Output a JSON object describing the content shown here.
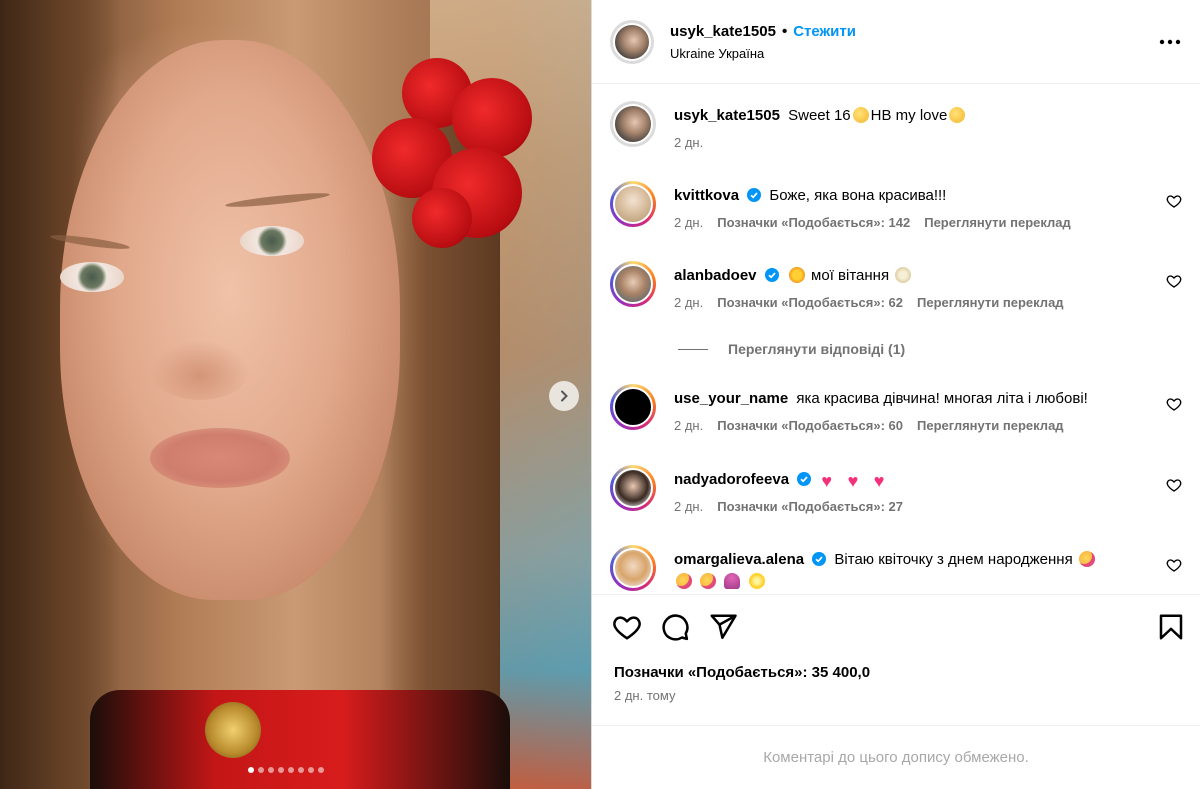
{
  "photo": {
    "alt_description_hidden": "",
    "carousel_dots": 8,
    "active_dot": 0
  },
  "header": {
    "username": "usyk_kate1505",
    "separator": "•",
    "follow_label": "Стежити",
    "location": "Ukraine Україна"
  },
  "caption": {
    "username": "usyk_kate1505",
    "text_part1": "Sweet 16",
    "text_part2": "HB my love",
    "time": "2 дн."
  },
  "comments": [
    {
      "username": "kvittkova",
      "verified": true,
      "text": "Боже, яка вона красива!!!",
      "time": "2 дн.",
      "likes": "Позначки «Подобається»: 142",
      "translate": "Переглянути переклад"
    },
    {
      "username": "alanbadoev",
      "verified": true,
      "text": "мої вітання",
      "time": "2 дн.",
      "likes": "Позначки «Подобається»: 62",
      "translate": "Переглянути переклад"
    },
    {
      "username": "use_your_name",
      "verified": false,
      "text": "яка красива дівчина! многая літа і любові!",
      "time": "2 дн.",
      "likes": "Позначки «Подобається»: 60",
      "translate": "Переглянути переклад"
    },
    {
      "username": "nadyadorofeeva",
      "verified": true,
      "text": "",
      "time": "2 дн.",
      "likes": "Позначки «Подобається»: 27",
      "translate": ""
    },
    {
      "username": "omargalieva.alena",
      "verified": true,
      "text": "Вітаю квіточку з днем народження",
      "time": "",
      "likes": "",
      "translate": ""
    }
  ],
  "view_replies": "Переглянути відповіді (1)",
  "actions": {
    "likes_label": "Позначки «Подобається»: 35 400,0",
    "posted_time": "2 дн. тому"
  },
  "comments_limited": "Коментарі до цього допису обмежено.",
  "colors": {
    "accent": "#0095f6",
    "muted": "#737373",
    "verified": "#0095f6",
    "heart_emoji": "#f5307a"
  }
}
